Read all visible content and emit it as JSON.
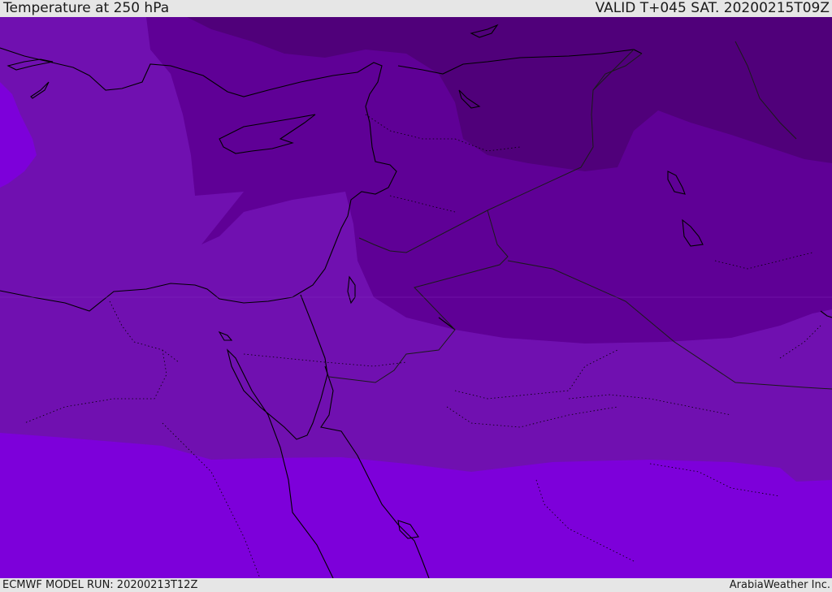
{
  "header": {
    "title": "Temperature at 250 hPa",
    "valid_time": "VALID T+045 SAT. 20200215T09Z"
  },
  "footer": {
    "model_run": "ECMWF MODEL RUN: 20200213T12Z",
    "credit": "ArabiaWeather Inc."
  },
  "colors": {
    "band_coldest": "#50007a",
    "band_cold": "#5f0096",
    "band_mid": "#7010b0",
    "band_warm": "#7d00da",
    "coastline": "#000000",
    "border": "#1a1a1a",
    "bar_background": "#e6e6e6"
  }
}
